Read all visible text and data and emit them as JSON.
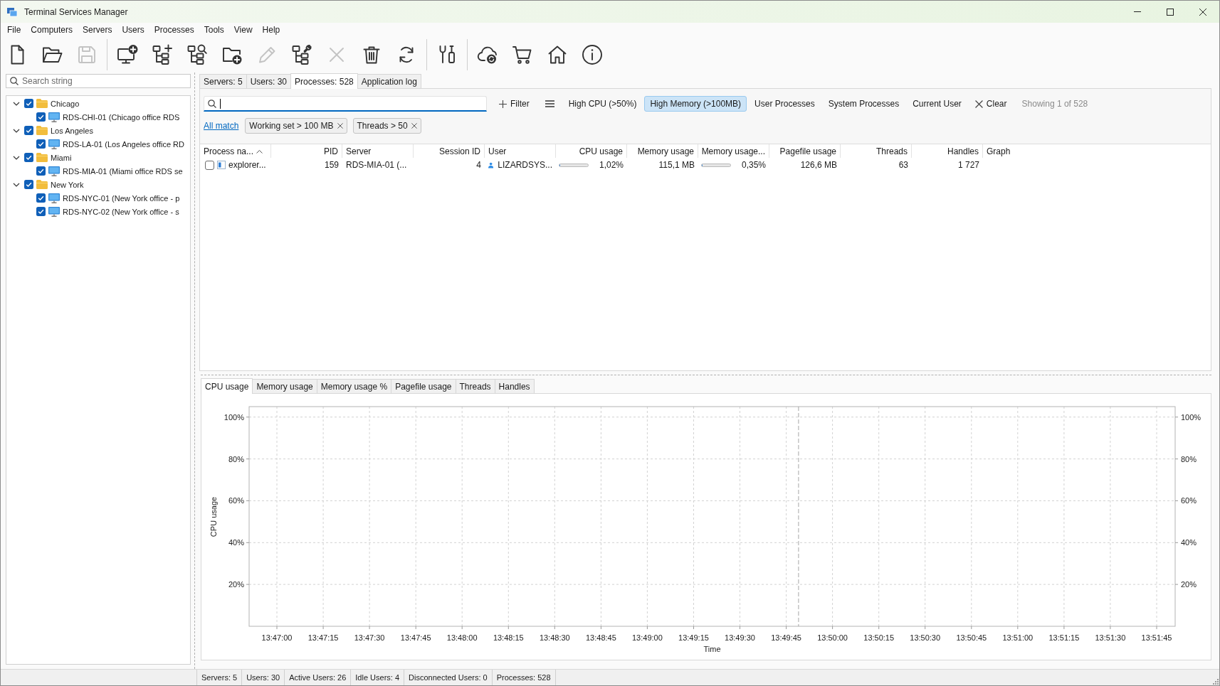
{
  "window": {
    "title": "Terminal Services Manager"
  },
  "menu": [
    "File",
    "Computers",
    "Servers",
    "Users",
    "Processes",
    "Tools",
    "View",
    "Help"
  ],
  "toolbar": [
    {
      "buttons": [
        {
          "kind": "new",
          "disabled": false
        },
        {
          "kind": "open",
          "disabled": false
        },
        {
          "kind": "save",
          "disabled": true
        }
      ]
    },
    {
      "buttons": [
        {
          "kind": "computer",
          "disabled": false
        },
        {
          "kind": "branch",
          "disabled": false
        },
        {
          "kind": "find",
          "disabled": false
        },
        {
          "kind": "folder",
          "disabled": false
        },
        {
          "kind": "edit",
          "disabled": true
        },
        {
          "kind": "configure",
          "disabled": false
        },
        {
          "kind": "remove",
          "disabled": true
        },
        {
          "kind": "trash",
          "disabled": false
        },
        {
          "kind": "refresh",
          "disabled": false
        }
      ]
    },
    {
      "buttons": [
        {
          "kind": "tools",
          "disabled": false
        }
      ]
    },
    {
      "buttons": [
        {
          "kind": "cloud",
          "disabled": false
        },
        {
          "kind": "cart",
          "disabled": false
        },
        {
          "kind": "home",
          "disabled": false
        },
        {
          "kind": "info",
          "disabled": false
        }
      ]
    }
  ],
  "sidebar": {
    "search": {
      "placeholder": "Search string"
    },
    "tree": [
      {
        "label": "Chicago",
        "kind": "location",
        "expanded": true,
        "checked": true,
        "children": [
          {
            "label": "RDS-CHI-01 (Chicago office RDS",
            "kind": "server",
            "checked": true
          }
        ]
      },
      {
        "label": "Los Angeles",
        "kind": "location",
        "expanded": true,
        "checked": true,
        "children": [
          {
            "label": "RDS-LA-01 (Los Angeles office RD",
            "kind": "server",
            "checked": true
          }
        ]
      },
      {
        "label": "Miami",
        "kind": "location",
        "expanded": true,
        "checked": true,
        "children": [
          {
            "label": "RDS-MIA-01 (Miami office RDS se",
            "kind": "server",
            "checked": true
          }
        ]
      },
      {
        "label": "New York",
        "kind": "location",
        "expanded": true,
        "checked": true,
        "children": [
          {
            "label": "RDS-NYC-01 (New York office - p",
            "kind": "server",
            "checked": true
          },
          {
            "label": "RDS-NYC-02 (New York office - s",
            "kind": "server",
            "checked": true
          }
        ]
      }
    ]
  },
  "tabs": [
    {
      "label": "Servers: 5",
      "selected": false
    },
    {
      "label": "Users: 30",
      "selected": false
    },
    {
      "label": "Processes: 528",
      "selected": true
    },
    {
      "label": "Application log",
      "selected": false
    }
  ],
  "filter_bar": {
    "add_filter": "Filter",
    "quick_filters": [
      {
        "label": "High CPU (>50%)",
        "selected": false
      },
      {
        "label": "High Memory (>100MB)",
        "selected": true
      },
      {
        "label": "User Processes",
        "selected": false
      },
      {
        "label": "System Processes",
        "selected": false
      },
      {
        "label": "Current User",
        "selected": false
      }
    ],
    "clear": "Clear",
    "summary": "Showing 1 of 528",
    "match_mode": "All match",
    "chips": [
      "Working set > 100 MB",
      "Threads > 50"
    ]
  },
  "table": {
    "columns": [
      {
        "label": "Process na...",
        "kind": "name",
        "sorted": true
      },
      {
        "label": "PID",
        "kind": "number",
        "sorted": false
      },
      {
        "label": "Server",
        "kind": "text",
        "sorted": false
      },
      {
        "label": "Session ID",
        "kind": "number",
        "sorted": false
      },
      {
        "label": "User",
        "kind": "user",
        "sorted": false
      },
      {
        "label": "CPU usage",
        "kind": "meter",
        "sorted": false
      },
      {
        "label": "Memory usage",
        "kind": "number",
        "sorted": false
      },
      {
        "label": "Memory usage...",
        "kind": "meter",
        "sorted": false
      },
      {
        "label": "Pagefile usage",
        "kind": "number",
        "sorted": false
      },
      {
        "label": "Threads",
        "kind": "number",
        "sorted": false
      },
      {
        "label": "Handles",
        "kind": "number",
        "sorted": false
      },
      {
        "label": "Graph",
        "kind": "graph",
        "sorted": false
      }
    ],
    "rows": [
      {
        "checked": false,
        "cells": [
          {
            "text": "explorer..."
          },
          {
            "text": "159"
          },
          {
            "text": "RDS-MIA-01 (..."
          },
          {
            "text": "4"
          },
          {
            "text": "LIZARDSYS..."
          },
          {
            "text": "1,02%",
            "level": 0.0102
          },
          {
            "text": "115,1 MB"
          },
          {
            "text": "0,35%",
            "level": 0.0035
          },
          {
            "text": "126,6 MB"
          },
          {
            "text": "63"
          },
          {
            "text": "1 727"
          }
        ]
      }
    ]
  },
  "chart_tabs": [
    {
      "label": "CPU usage",
      "selected": true
    },
    {
      "label": "Memory usage",
      "selected": false
    },
    {
      "label": "Memory usage %",
      "selected": false
    },
    {
      "label": "Pagefile usage",
      "selected": false
    },
    {
      "label": "Threads",
      "selected": false
    },
    {
      "label": "Handles",
      "selected": false
    }
  ],
  "chart": {
    "chart_data": {
      "type": "line",
      "xlabel": "Time",
      "ylabel": "CPU usage",
      "grid": true,
      "xlim": [
        49611,
        49911
      ],
      "ylim": [
        0,
        105
      ],
      "xticks": [
        {
          "value": 49620,
          "label": "13:47:00"
        },
        {
          "value": 49635,
          "label": "13:47:15"
        },
        {
          "value": 49650,
          "label": "13:47:30"
        },
        {
          "value": 49665,
          "label": "13:47:45"
        },
        {
          "value": 49680,
          "label": "13:48:00"
        },
        {
          "value": 49695,
          "label": "13:48:15"
        },
        {
          "value": 49710,
          "label": "13:48:30"
        },
        {
          "value": 49725,
          "label": "13:48:45"
        },
        {
          "value": 49740,
          "label": "13:49:00"
        },
        {
          "value": 49755,
          "label": "13:49:15"
        },
        {
          "value": 49770,
          "label": "13:49:30"
        },
        {
          "value": 49785,
          "label": "13:49:45"
        },
        {
          "value": 49800,
          "label": "13:50:00"
        },
        {
          "value": 49815,
          "label": "13:50:15"
        },
        {
          "value": 49830,
          "label": "13:50:30"
        },
        {
          "value": 49845,
          "label": "13:50:45"
        },
        {
          "value": 49860,
          "label": "13:51:00"
        },
        {
          "value": 49875,
          "label": "13:51:15"
        },
        {
          "value": 49890,
          "label": "13:51:30"
        },
        {
          "value": 49905,
          "label": "13:51:45"
        }
      ],
      "yticks": [
        {
          "value": 20,
          "label": "20%"
        },
        {
          "value": 40,
          "label": "40%"
        },
        {
          "value": 60,
          "label": "60%"
        },
        {
          "value": 80,
          "label": "80%"
        },
        {
          "value": 100,
          "label": "100%"
        }
      ],
      "ref_lines": [
        {
          "axis": "x",
          "value": 49789
        }
      ]
    },
    "secondary_ytick_labels": [
      "100%",
      "80%",
      "60%",
      "40%",
      "20%"
    ]
  },
  "status_bar": [
    "Servers: 5",
    "Users: 30",
    "Active Users: 26",
    "Idle Users: 4",
    "Disconnected Users: 0",
    "Processes: 528"
  ]
}
